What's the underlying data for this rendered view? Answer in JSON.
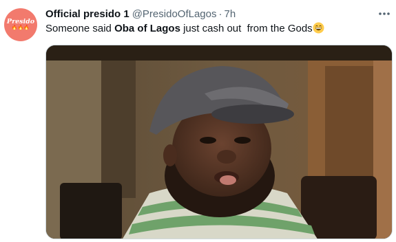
{
  "tweet": {
    "avatar_text": "Presido",
    "avatar_flames": "🔥🔥🔥",
    "display_name": "Official presido 1",
    "handle": "@PresidoOfLagos",
    "separator": "·",
    "time": "7h",
    "text_before": "Someone said ",
    "text_bold": "Oba of Lagos",
    "text_after": " just cash out  from the Gods",
    "emoji": "grinning-face-emoji",
    "more_icon": "more-horizontal-icon"
  },
  "media": {
    "description_icon": "photo-meme"
  },
  "colors": {
    "avatar_bg": "#f27a6d",
    "text_primary": "#0f1419",
    "text_secondary": "#536471",
    "border": "#cfd9de"
  }
}
